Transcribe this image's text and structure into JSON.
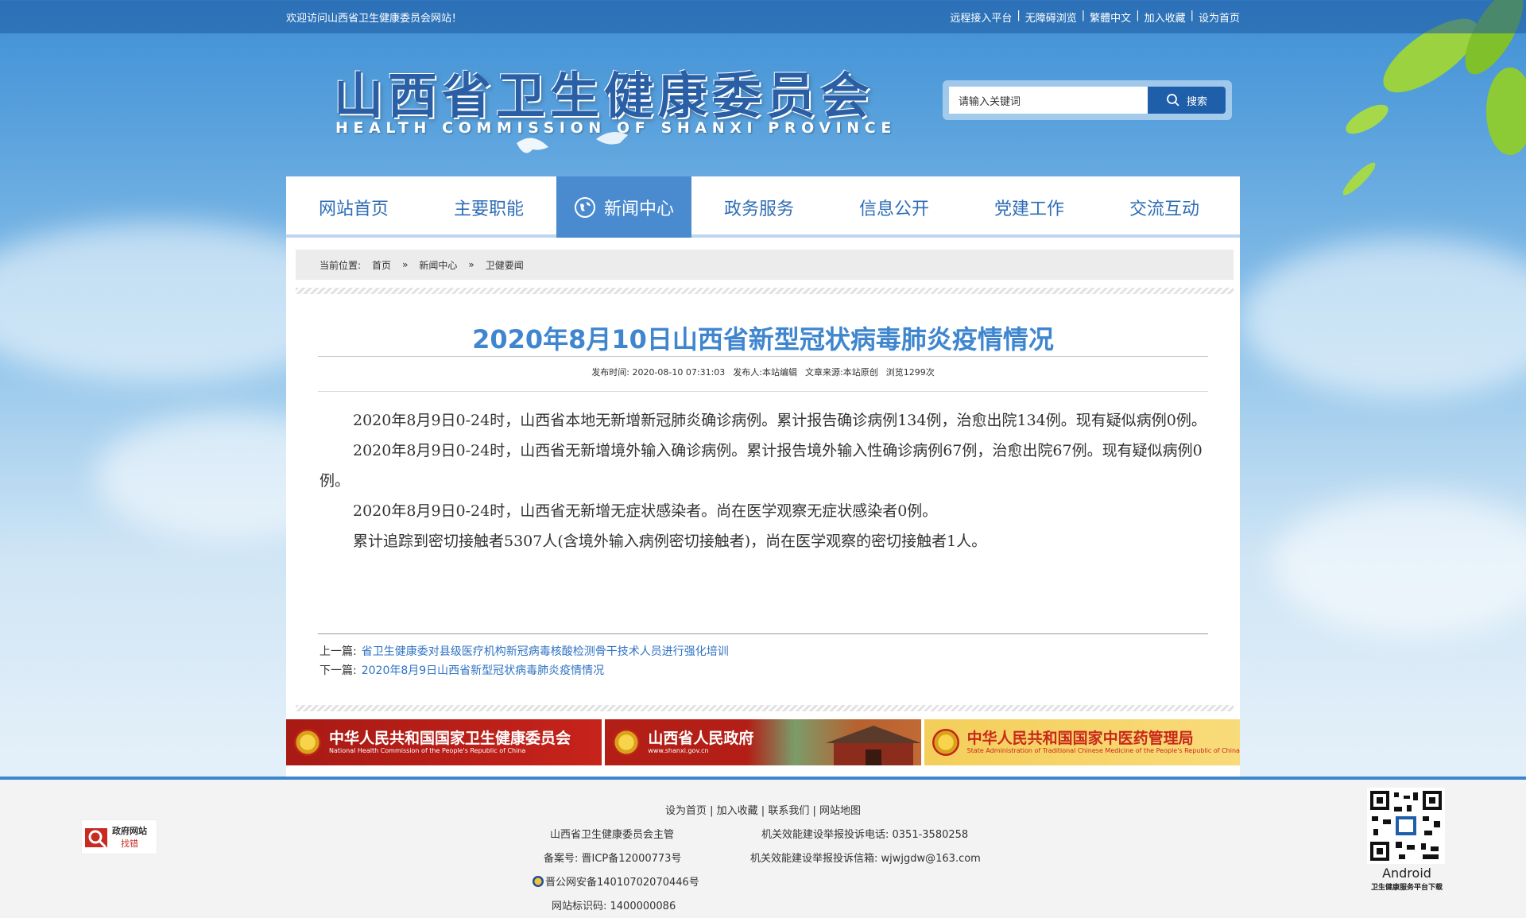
{
  "topbar": {
    "welcome": "欢迎访问山西省卫生健康委员会网站！",
    "links": [
      "远程接入平台",
      "无障碍浏览",
      "繁體中文",
      "加入收藏",
      "设为首页"
    ]
  },
  "header": {
    "title_cn": "山西省卫生健康委员会",
    "title_en": "HEALTH COMMISSION OF SHANXI PROVINCE",
    "search_placeholder": "请输入关键词",
    "search_button": "搜索"
  },
  "nav": {
    "items": [
      "网站首页",
      "主要职能",
      "新闻中心",
      "政务服务",
      "信息公开",
      "党建工作",
      "交流互动"
    ],
    "active": "新闻中心"
  },
  "breadcrumb": {
    "prefix": "当前位置:",
    "items": [
      "首页",
      "新闻中心",
      "卫健要闻"
    ],
    "sep": "»"
  },
  "article": {
    "title": "2020年8月10日山西省新型冠状病毒肺炎疫情情况",
    "meta": {
      "published_label": "发布时间:",
      "published": "2020-08-10 07:31:03",
      "author_label": "发布人:",
      "author": "本站编辑",
      "source_label": "文章来源:",
      "source": "本站原创",
      "views": "浏览1299次"
    },
    "paragraphs": [
      "2020年8月9日0-24时，山西省本地无新增新冠肺炎确诊病例。累计报告确诊病例134例，治愈出院134例。现有疑似病例0例。",
      "2020年8月9日0-24时，山西省无新增境外输入确诊病例。累计报告境外输入性确诊病例67例，治愈出院67例。现有疑似病例0例。",
      "2020年8月9日0-24时，山西省无新增无症状感染者。尚在医学观察无症状感染者0例。",
      "累计追踪到密切接触者5307人(含境外输入病例密切接触者)，尚在医学观察的密切接触者1人。"
    ],
    "prev_label": "上一篇:",
    "prev": "省卫生健康委对县级医疗机构新冠病毒核酸检测骨干技术人员进行强化培训",
    "next_label": "下一篇:",
    "next": "2020年8月9日山西省新型冠状病毒肺炎疫情情况"
  },
  "banners": [
    {
      "title": "中华人民共和国国家卫生健康委员会",
      "subtitle": "National Health Commission of the People's Republic of China"
    },
    {
      "title": "山西省人民政府",
      "subtitle": "www.shanxi.gov.cn"
    },
    {
      "title": "中华人民共和国国家中医药管理局",
      "subtitle": "State Administration of Traditional Chinese Medicine of the People's Republic of China"
    }
  ],
  "footer": {
    "links": [
      "设为首页",
      "加入收藏",
      "联系我们",
      "网站地图"
    ],
    "sponsor": "山西省卫生健康委员会主管",
    "complaint_phone": "机关效能建设举报投诉电话:  0351-3580258",
    "icp": "备案号:  晋ICP备12000773号",
    "complaint_email": "机关效能建设举报投诉信箱:  wjwjgdw@163.com",
    "police": "晋公网安备14010702070446号",
    "site_id": "网站标识码:  1400000086",
    "badge_line1": "政府网站",
    "badge_line2": "找错",
    "qr_caption1": "Android",
    "qr_caption2": "卫生健康服务平台下载"
  },
  "colors": {
    "nav_active": "#4a8bd0",
    "nav_text": "#2f6db5",
    "title": "#3f86cf",
    "link": "#2f72c2",
    "footer_border": "#3c86cf"
  }
}
